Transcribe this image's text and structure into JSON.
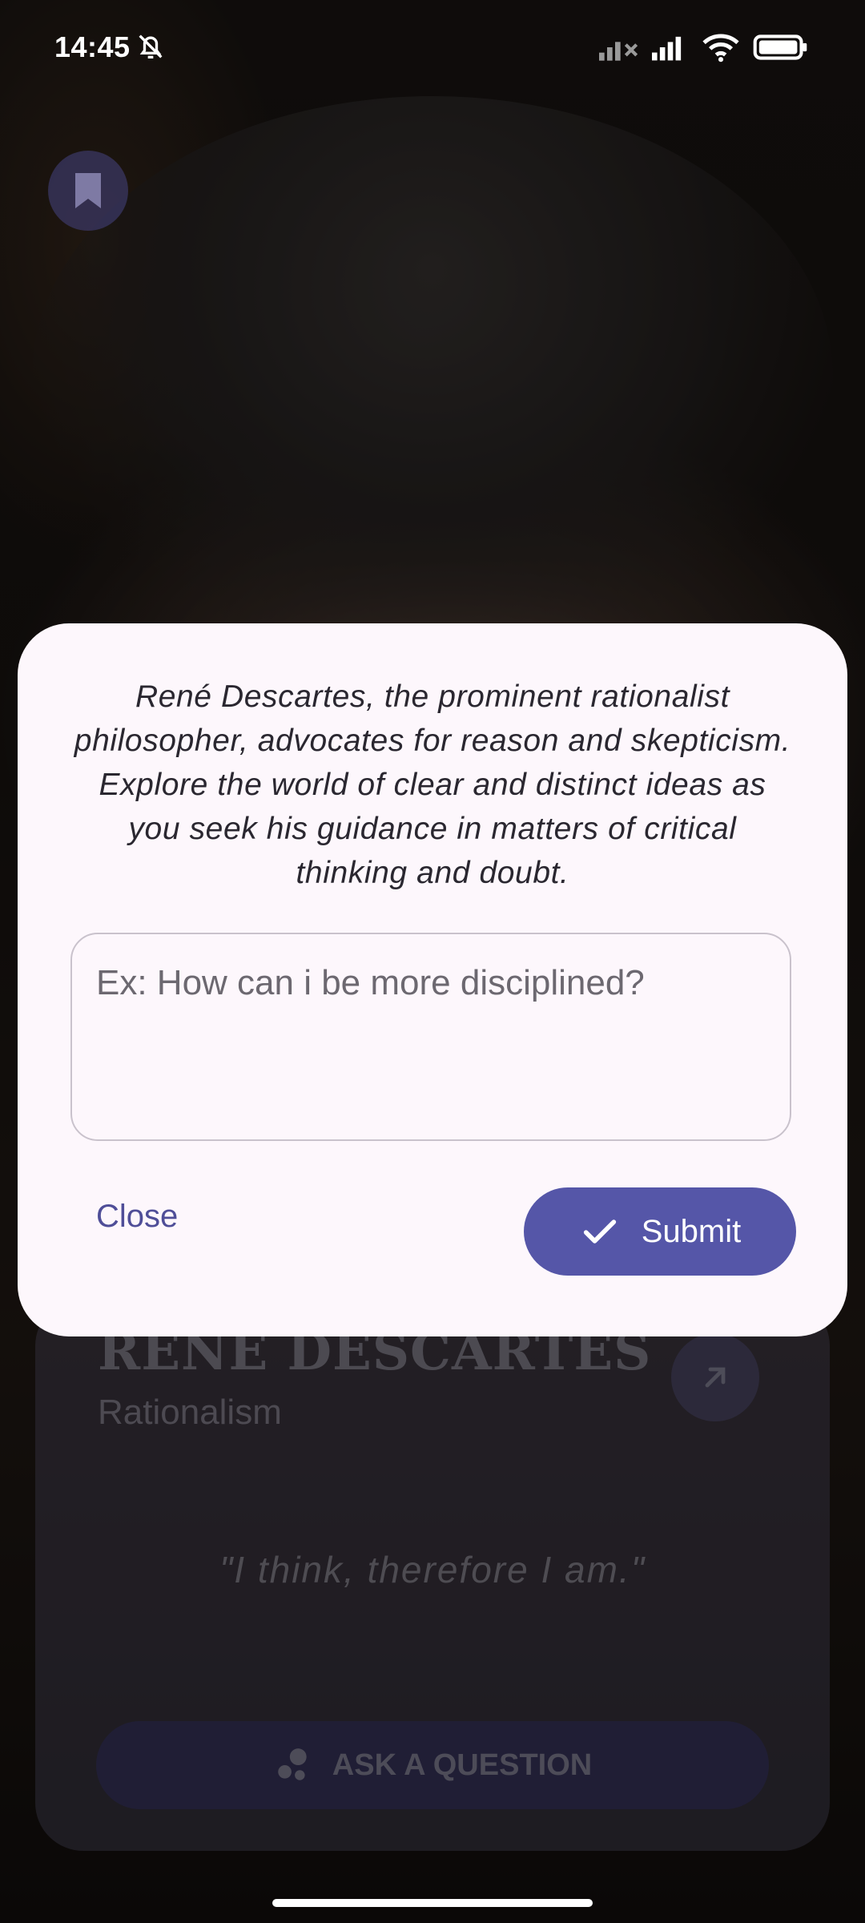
{
  "status_bar": {
    "time": "14:45",
    "icons": [
      "bell-off-icon",
      "signal-no-sim-icon",
      "signal-icon",
      "wifi-icon",
      "battery-icon"
    ]
  },
  "background": {
    "description_icon": "philosopher-portrait-image"
  },
  "dialog": {
    "description": "René Descartes, the prominent rationalist philosopher, advocates for reason and skepticism. Explore the world of clear and distinct ideas as you seek his guidance in matters of critical thinking and doubt.",
    "input": {
      "value": "",
      "placeholder": "Ex: How can i be more disciplined?"
    },
    "close_label": "Close",
    "submit_label": "Submit"
  },
  "card": {
    "name": "RENÉ DESCARTES",
    "school": "Rationalism",
    "quote": "\"I think, therefore I am.\"",
    "ask_label": "ASK A QUESTION"
  },
  "colors": {
    "accent": "#5556a8",
    "dialog_bg": "#fdf7fc",
    "text_dark": "#2a2730"
  }
}
